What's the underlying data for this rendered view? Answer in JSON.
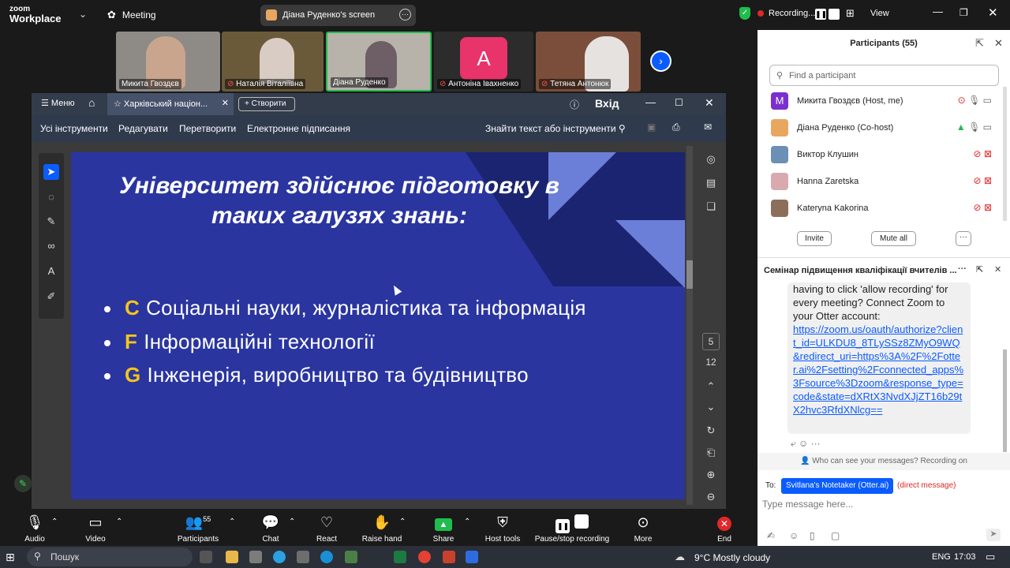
{
  "app": {
    "brand_top": "zoom",
    "brand_bottom": "Workplace",
    "meeting_label": "Meeting",
    "screen_share_label": "Діана Руденко's screen"
  },
  "recording": {
    "label": "Recording...",
    "view_label": "View"
  },
  "video_strip": [
    {
      "name": "Микита Гвоздєв",
      "muted": false
    },
    {
      "name": "Наталія Віталіївна",
      "muted": true
    },
    {
      "name": "Діана Руденко",
      "muted": false
    },
    {
      "name": "Антоніна Івахненко",
      "muted": true
    },
    {
      "name": "Тетяна Антонюк",
      "muted": true
    }
  ],
  "pdf": {
    "menu_label": "Меню",
    "tab_label": "Харківський націон...",
    "create_label": "Створити",
    "login_label": "Вхід",
    "tools": [
      "Усі інструменти",
      "Редагувати",
      "Перетворити",
      "Електронне підписання"
    ],
    "find_label": "Знайти текст або інструменти",
    "page_current": "5",
    "page_total": "12"
  },
  "slide": {
    "title_line1": "Університет здійснює підготовку в",
    "title_line2": "таких галузях знань:",
    "bullets": [
      {
        "letter": "C",
        "text": "Соціальні науки, журналістика та інформація"
      },
      {
        "letter": "F",
        "text": "Інформаційні технології"
      },
      {
        "letter": "G",
        "text": "Інженерія, виробництво та будівництво"
      }
    ]
  },
  "participants": {
    "title": "Participants (55)",
    "search_placeholder": "Find a participant",
    "list": [
      {
        "name": "Микита Гвоздєв (Host, me)",
        "initial": "M",
        "color": "#7b2fd0"
      },
      {
        "name": "Діана Руденко (Co-host)",
        "initial": "",
        "color": "#e8a75f"
      },
      {
        "name": "Виктор Клушин",
        "initial": "",
        "color": "#6b8fb5"
      },
      {
        "name": "Hanna Zaretska",
        "initial": "",
        "color": "#d9a9b0"
      },
      {
        "name": "Kateryna Kakorina",
        "initial": "",
        "color": "#8b6f5a"
      }
    ],
    "invite_label": "Invite",
    "mute_all_label": "Mute all"
  },
  "chat": {
    "title": "Семінар підвищення кваліфікації вчителів ...",
    "message_text": "having to click 'allow recording' for every meeting? Connect Zoom to your Otter account:",
    "message_link": "https://zoom.us/oauth/authorize?client_id=ULKDU8_8TLySSz8ZMyO9WQ&redirect_uri=https%3A%2F%2Fotter.ai%2Fsetting%2Fconnected_apps%3Fsource%3Dzoom&response_type=code&state=dXRtX3NvdXJjZT16b29tX2hvc3RfdXNlcg==",
    "visibility_note": "Who can see your messages? Recording on",
    "to_label": "To:",
    "to_target": "Svitlana's Notetaker (Otter.ai)",
    "direct_note": "(direct message)",
    "input_placeholder": "Type message here..."
  },
  "toolbar": [
    {
      "label": "Audio",
      "icon": "mic-icon"
    },
    {
      "label": "Video",
      "icon": "camera-icon"
    },
    {
      "label": "Participants",
      "icon": "people-icon",
      "count": "55"
    },
    {
      "label": "Chat",
      "icon": "chat-icon"
    },
    {
      "label": "React",
      "icon": "heart-icon"
    },
    {
      "label": "Raise hand",
      "icon": "hand-icon"
    },
    {
      "label": "Share",
      "icon": "share-icon"
    },
    {
      "label": "Host tools",
      "icon": "shield-icon"
    },
    {
      "label": "Pause/stop recording",
      "icon": "record-icon"
    },
    {
      "label": "More",
      "icon": "more-icon"
    },
    {
      "label": "End",
      "icon": "end-icon"
    }
  ],
  "taskbar": {
    "search_placeholder": "Пошук",
    "weather": "9°C  Mostly cloudy",
    "lang": "ENG",
    "time": "17:03"
  },
  "colors": {
    "accent": "#0b5cff",
    "slide_bg": "#2a35a0",
    "slide_letter": "#f5c518",
    "end_red": "#e02828",
    "share_green": "#1fbd4d"
  }
}
